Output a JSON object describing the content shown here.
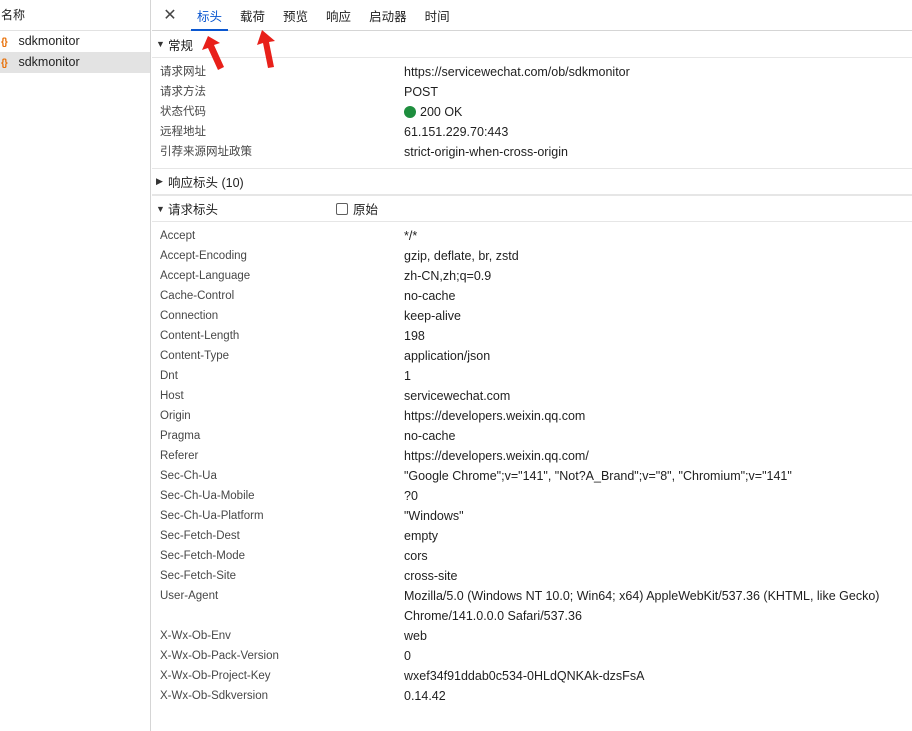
{
  "request_list": {
    "header": "名称",
    "items": [
      {
        "icon": "{}",
        "name": "sdkmonitor",
        "selected": false
      },
      {
        "icon": "{}",
        "name": "sdkmonitor",
        "selected": true
      }
    ]
  },
  "tabs": {
    "close": "✕",
    "items": [
      "标头",
      "载荷",
      "预览",
      "响应",
      "启动器",
      "时间"
    ],
    "active": "标头"
  },
  "general": {
    "title": "常规",
    "rows": [
      {
        "key": "请求网址",
        "value": "https://servicewechat.com/ob/sdkmonitor"
      },
      {
        "key": "请求方法",
        "value": "POST"
      },
      {
        "key": "状态代码",
        "value": "200 OK"
      },
      {
        "key": "远程地址",
        "value": "61.151.229.70:443"
      },
      {
        "key": "引荐来源网址政策",
        "value": "strict-origin-when-cross-origin"
      }
    ]
  },
  "response_headers": {
    "title": "响应标头 (10)",
    "collapsed": true
  },
  "request_headers": {
    "title": "请求标头",
    "raw_label": "原始",
    "rows": [
      {
        "key": "Accept",
        "value": "*/*"
      },
      {
        "key": "Accept-Encoding",
        "value": "gzip, deflate, br, zstd"
      },
      {
        "key": "Accept-Language",
        "value": "zh-CN,zh;q=0.9"
      },
      {
        "key": "Cache-Control",
        "value": "no-cache"
      },
      {
        "key": "Connection",
        "value": "keep-alive"
      },
      {
        "key": "Content-Length",
        "value": "198"
      },
      {
        "key": "Content-Type",
        "value": "application/json"
      },
      {
        "key": "Dnt",
        "value": "1"
      },
      {
        "key": "Host",
        "value": "servicewechat.com"
      },
      {
        "key": "Origin",
        "value": "https://developers.weixin.qq.com"
      },
      {
        "key": "Pragma",
        "value": "no-cache"
      },
      {
        "key": "Referer",
        "value": "https://developers.weixin.qq.com/"
      },
      {
        "key": "Sec-Ch-Ua",
        "value": "\"Google Chrome\";v=\"141\", \"Not?A_Brand\";v=\"8\", \"Chromium\";v=\"141\""
      },
      {
        "key": "Sec-Ch-Ua-Mobile",
        "value": "?0"
      },
      {
        "key": "Sec-Ch-Ua-Platform",
        "value": "\"Windows\""
      },
      {
        "key": "Sec-Fetch-Dest",
        "value": "empty"
      },
      {
        "key": "Sec-Fetch-Mode",
        "value": "cors"
      },
      {
        "key": "Sec-Fetch-Site",
        "value": "cross-site"
      },
      {
        "key": "User-Agent",
        "value": "Mozilla/5.0 (Windows NT 10.0; Win64; x64) AppleWebKit/537.36 (KHTML, like Gecko) Chrome/141.0.0.0 Safari/537.36"
      },
      {
        "key": "X-Wx-Ob-Env",
        "value": "web"
      },
      {
        "key": "X-Wx-Ob-Pack-Version",
        "value": "0"
      },
      {
        "key": "X-Wx-Ob-Project-Key",
        "value": "wxef34f91ddab0c534-0HLdQNKAk-dzsFsA"
      },
      {
        "key": "X-Wx-Ob-Sdkversion",
        "value": "0.14.42"
      }
    ]
  },
  "colors": {
    "accent": "#0b57d0",
    "status_ok": "#1e8e3e",
    "json_icon": "#e8710a",
    "annotation_arrow": "#e8201a"
  }
}
